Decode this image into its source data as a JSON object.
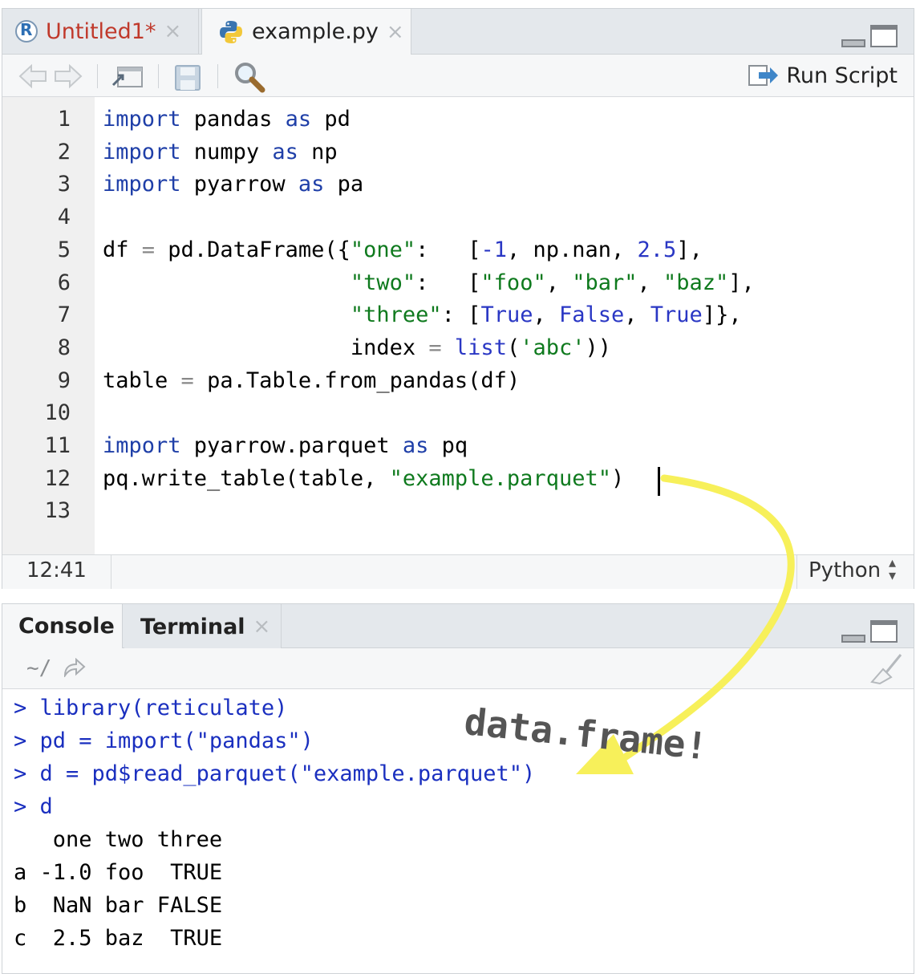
{
  "editor": {
    "tabs": [
      {
        "label": "Untitled1*",
        "close": "×",
        "color": "#c0392b"
      },
      {
        "label": "example.py",
        "close": "×",
        "color": "#222222"
      }
    ],
    "toolbar": {
      "run_script_label": "Run Script"
    },
    "line_numbers": [
      "1",
      "2",
      "3",
      "4",
      "5",
      "6",
      "7",
      "8",
      "9",
      "10",
      "11",
      "12",
      "13"
    ],
    "code_lines": [
      "import pandas as pd",
      "import numpy as np",
      "import pyarrow as pa",
      "",
      "df = pd.DataFrame({\"one\":   [-1, np.nan, 2.5],",
      "                   \"two\":   [\"foo\", \"bar\", \"baz\"],",
      "                   \"three\": [True, False, True]},",
      "                   index = list('abc'))",
      "table = pa.Table.from_pandas(df)",
      "",
      "import pyarrow.parquet as pq",
      "pq.write_table(table, \"example.parquet\")",
      ""
    ],
    "status": {
      "cursor_position": "12:41",
      "language": "Python"
    }
  },
  "console": {
    "tabs": [
      {
        "label": "Console"
      },
      {
        "label": "Terminal",
        "close": "×"
      }
    ],
    "working_dir": "~/",
    "input_lines": [
      "> library(reticulate)",
      "> pd = import(\"pandas\")",
      "> d = pd$read_parquet(\"example.parquet\")",
      "> d"
    ],
    "output_lines": [
      "   one two three",
      "a -1.0 foo  TRUE",
      "b  NaN bar FALSE",
      "c  2.5 baz  TRUE"
    ]
  },
  "annotation": {
    "text": "data.frame!",
    "arrow_color": "#f7f05a"
  },
  "colors": {
    "keyword": "#1f3fa8",
    "string": "#0f7a1e",
    "number": "#2a37c4",
    "console_input": "#1a2fbf"
  }
}
